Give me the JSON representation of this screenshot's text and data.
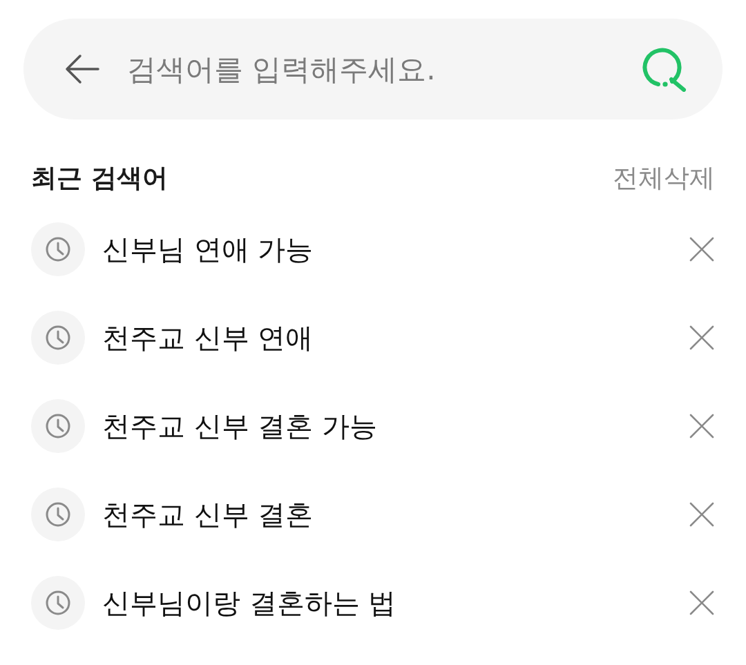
{
  "search": {
    "placeholder": "검색어를 입력해주세요."
  },
  "recent": {
    "title": "최근 검색어",
    "clear_all": "전체삭제",
    "items": [
      {
        "query": "신부님 연애 가능"
      },
      {
        "query": "천주교 신부 연애"
      },
      {
        "query": "천주교 신부 결혼 가능"
      },
      {
        "query": "천주교 신부 결혼"
      },
      {
        "query": "신부님이랑 결혼하는 법"
      }
    ]
  }
}
